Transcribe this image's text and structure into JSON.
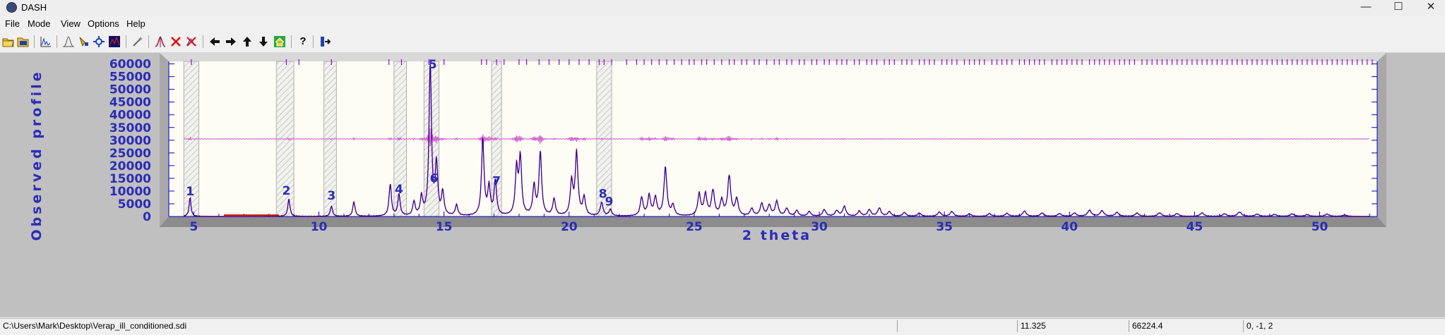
{
  "window": {
    "title": "DASH",
    "minimize": "—",
    "maximize": "☐",
    "close": "✕"
  },
  "menu": [
    "File",
    "Mode",
    "View",
    "Options",
    "Help"
  ],
  "toolbar": {
    "icons": [
      "open-folder-icon",
      "open-file-icon",
      "profile-plot-icon",
      "peak-fit-icon",
      "highlight-tool-icon",
      "select-tool-icon",
      "graph-icon",
      "wand-icon",
      "add-peak-icon",
      "delete-peak-icon",
      "delete-all-peaks-icon",
      "arrow-left-icon",
      "arrow-right-icon",
      "arrow-up-icon",
      "arrow-down-icon",
      "home-icon",
      "help-icon",
      "exit-icon"
    ],
    "help_label": "?"
  },
  "colors": {
    "plot_bg": "#fdfdf5",
    "axis": "#0000cc",
    "observed": "#b0006a",
    "calc": "#0000aa",
    "difference": "#cc55cc",
    "tick": "#9900cc",
    "baseline": "#cc2200",
    "label": "#2b2bb8"
  },
  "chart_data": {
    "type": "line",
    "ylabel": "Observed  profile",
    "xlabel": "2  theta",
    "xlim": [
      4,
      52.3
    ],
    "ylim": [
      0,
      61000
    ],
    "y_ticks": [
      0,
      5000,
      10000,
      15000,
      20000,
      25000,
      30000,
      35000,
      40000,
      45000,
      50000,
      55000,
      60000
    ],
    "x_ticks": [
      5,
      10,
      15,
      20,
      25,
      30,
      35,
      40,
      45,
      50
    ],
    "difference_offset": 30500,
    "excluded_regions": [
      [
        4.6,
        5.2
      ],
      [
        8.3,
        9.0
      ],
      [
        10.2,
        10.7
      ],
      [
        13.0,
        13.5
      ],
      [
        14.2,
        14.8
      ],
      [
        16.9,
        17.3
      ],
      [
        21.1,
        21.7
      ]
    ],
    "peak_labels": [
      {
        "label": "1",
        "x": 4.85,
        "y": 8300
      },
      {
        "label": "2",
        "x": 8.7,
        "y": 8600
      },
      {
        "label": "3",
        "x": 10.5,
        "y": 6600
      },
      {
        "label": "4",
        "x": 13.2,
        "y": 9200
      },
      {
        "label": "5",
        "x": 14.55,
        "y": 58200
      },
      {
        "label": "6",
        "x": 14.6,
        "y": 13400
      },
      {
        "label": "7",
        "x": 17.1,
        "y": 12400
      },
      {
        "label": "8",
        "x": 21.35,
        "y": 7300
      },
      {
        "label": "9",
        "x": 21.6,
        "y": 4300
      }
    ],
    "peaks": [
      [
        4.85,
        7300
      ],
      [
        8.8,
        6800
      ],
      [
        10.5,
        4000
      ],
      [
        11.4,
        5700
      ],
      [
        12.85,
        12500
      ],
      [
        13.2,
        8500
      ],
      [
        13.8,
        5500
      ],
      [
        14.1,
        7200
      ],
      [
        14.45,
        60000
      ],
      [
        14.7,
        20000
      ],
      [
        14.95,
        9000
      ],
      [
        15.5,
        4200
      ],
      [
        16.55,
        30000
      ],
      [
        16.8,
        11000
      ],
      [
        17.05,
        13500
      ],
      [
        17.9,
        18000
      ],
      [
        18.05,
        22500
      ],
      [
        18.6,
        11500
      ],
      [
        18.85,
        25000
      ],
      [
        19.4,
        6500
      ],
      [
        20.1,
        13000
      ],
      [
        20.3,
        24500
      ],
      [
        20.6,
        7000
      ],
      [
        21.3,
        5200
      ],
      [
        21.65,
        2500
      ],
      [
        22.9,
        7200
      ],
      [
        23.2,
        7800
      ],
      [
        23.45,
        7000
      ],
      [
        23.85,
        19000
      ],
      [
        24.15,
        4000
      ],
      [
        25.2,
        8500
      ],
      [
        25.45,
        8300
      ],
      [
        25.75,
        9800
      ],
      [
        26.1,
        6000
      ],
      [
        26.4,
        15500
      ],
      [
        26.7,
        6500
      ],
      [
        27.3,
        2900
      ],
      [
        27.7,
        4800
      ],
      [
        28.0,
        4200
      ],
      [
        28.3,
        5700
      ],
      [
        28.7,
        3000
      ],
      [
        29.1,
        2200
      ],
      [
        29.6,
        1800
      ],
      [
        30.2,
        2600
      ],
      [
        30.7,
        2200
      ],
      [
        31.0,
        3800
      ],
      [
        31.6,
        2000
      ],
      [
        32.0,
        2600
      ],
      [
        32.4,
        3200
      ],
      [
        32.8,
        1800
      ],
      [
        33.4,
        1500
      ],
      [
        34.0,
        1300
      ],
      [
        34.8,
        1700
      ],
      [
        35.3,
        1900
      ],
      [
        36.0,
        1000
      ],
      [
        36.8,
        1100
      ],
      [
        37.5,
        1200
      ],
      [
        38.2,
        2100
      ],
      [
        38.9,
        1300
      ],
      [
        39.6,
        1100
      ],
      [
        40.2,
        1300
      ],
      [
        40.8,
        2400
      ],
      [
        41.3,
        2200
      ],
      [
        41.9,
        1600
      ],
      [
        42.7,
        1300
      ],
      [
        43.6,
        1400
      ],
      [
        44.3,
        1100
      ],
      [
        45.3,
        1400
      ],
      [
        46.2,
        1000
      ],
      [
        46.8,
        1700
      ],
      [
        47.5,
        900
      ],
      [
        48.2,
        800
      ],
      [
        48.9,
        1000
      ],
      [
        49.5,
        700
      ],
      [
        50.3,
        900
      ],
      [
        51.0,
        600
      ]
    ],
    "reflection_ticks": [
      4.9,
      8.7,
      9.2,
      10.5,
      12.8,
      13.3,
      14.4,
      15.0,
      16.5,
      16.7,
      17.1,
      17.4,
      18.0,
      18.3,
      18.8,
      19.2,
      19.6,
      20.0,
      20.4,
      20.8,
      21.2,
      21.4,
      21.7,
      22.3,
      22.7,
      23.0,
      23.3,
      23.6,
      23.9,
      24.2,
      24.5,
      24.8,
      25.0,
      25.3,
      25.5,
      25.8,
      26.1,
      26.4,
      26.6,
      26.9,
      27.1,
      27.4,
      27.6,
      27.9,
      28.2,
      28.4,
      28.7,
      28.9,
      29.2,
      29.4,
      29.7,
      29.9,
      30.2,
      30.4,
      30.7,
      30.9,
      31.1,
      31.4,
      31.6,
      31.9,
      32.1,
      32.3,
      32.6,
      32.8,
      33.0,
      33.3,
      33.5,
      33.7,
      34.0,
      34.2,
      34.4,
      34.6,
      34.9,
      35.1,
      35.3,
      35.5,
      35.8,
      36.0,
      36.2,
      36.4,
      36.6,
      36.9,
      37.1,
      37.3,
      37.5,
      37.7,
      38.0,
      38.2,
      38.4,
      38.6,
      38.8,
      39.0,
      39.3,
      39.5,
      39.7,
      39.9,
      40.1,
      40.3,
      40.5,
      40.8,
      41.0,
      41.2,
      41.4,
      41.6,
      41.8,
      42.0,
      42.2,
      42.4,
      42.6,
      42.9,
      43.1,
      43.3,
      43.5,
      43.7,
      43.9,
      44.1,
      44.3,
      44.5,
      44.7,
      44.9,
      45.1,
      45.3,
      45.5,
      45.7,
      45.9,
      46.1,
      46.3,
      46.5,
      46.7,
      46.9,
      47.1,
      47.3,
      47.5,
      47.7,
      47.9,
      48.1,
      48.3,
      48.5,
      48.7,
      48.9,
      49.1,
      49.3,
      49.5,
      49.7,
      49.9,
      50.1,
      50.3,
      50.5,
      50.7,
      50.9,
      51.1,
      51.3,
      51.5,
      51.7,
      51.9,
      52.1
    ]
  },
  "status": {
    "file": "C:\\Users\\Mark\\Desktop\\Verap_ill_conditioned.sdi",
    "empty": "",
    "x_value": "11.325",
    "y_value": "66224.4",
    "hkl": "0, -1,  2"
  }
}
